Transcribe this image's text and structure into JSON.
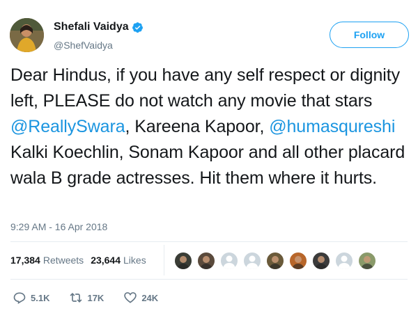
{
  "user": {
    "name": "Shefali Vaidya",
    "handle": "@ShefVaidya",
    "verified": true
  },
  "follow_label": "Follow",
  "tweet": {
    "segments": [
      {
        "text": "Dear Hindus, if you have any self respect or dignity left, PLEASE do not watch any movie that stars ",
        "mention": false
      },
      {
        "text": "@ReallySwara",
        "mention": true
      },
      {
        "text": ", Kareena Kapoor, ",
        "mention": false
      },
      {
        "text": "@humasqureshi",
        "mention": true
      },
      {
        "text": " Kalki Koechlin, Sonam Kapoor and all other placard wala B grade actresses. Hit them where it hurts.",
        "mention": false
      }
    ]
  },
  "timestamp": "9:29 AM - 16 Apr 2018",
  "stats": {
    "retweets": {
      "count": "17,384",
      "label": "Retweets"
    },
    "likes": {
      "count": "23,644",
      "label": "Likes"
    }
  },
  "likers": [
    {
      "kind": "photo",
      "color": "#3a3d36"
    },
    {
      "kind": "photo",
      "color": "#5a4a3c"
    },
    {
      "kind": "default",
      "color": "#ccd6dd"
    },
    {
      "kind": "default",
      "color": "#ccd6dd"
    },
    {
      "kind": "photo",
      "color": "#6a5a3a"
    },
    {
      "kind": "photo",
      "color": "#b8662a"
    },
    {
      "kind": "photo",
      "color": "#3b3b3b"
    },
    {
      "kind": "default",
      "color": "#ccd6dd"
    },
    {
      "kind": "photo",
      "color": "#8a9a6a"
    }
  ],
  "actions": {
    "reply": {
      "icon": "reply-icon",
      "count": "5.1K"
    },
    "retweet": {
      "icon": "retweet-icon",
      "count": "17K"
    },
    "like": {
      "icon": "heart-icon",
      "count": "24K"
    }
  },
  "colors": {
    "accent": "#1da1f2",
    "mention": "#1b95e0",
    "muted": "#657786",
    "text": "#14171a"
  }
}
